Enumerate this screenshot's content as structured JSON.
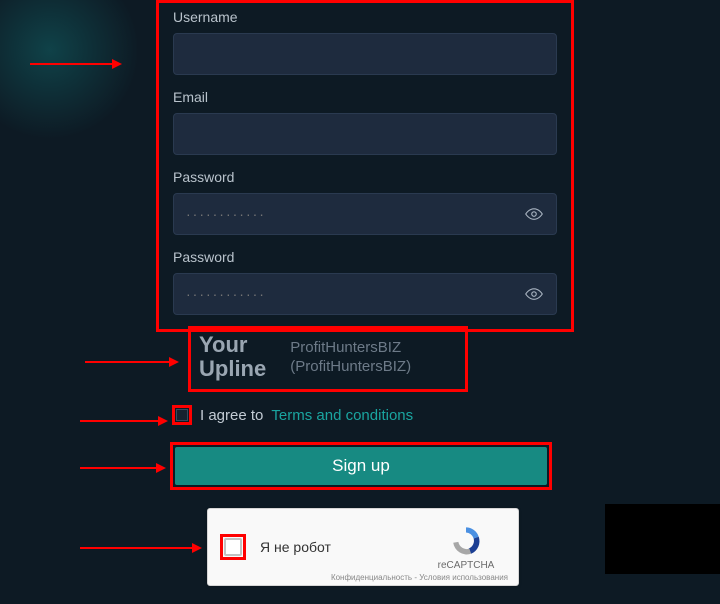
{
  "form": {
    "username_label": "Username",
    "username_value": "",
    "email_label": "Email",
    "email_value": "",
    "password1_label": "Password",
    "password1_placeholder": "············",
    "password2_label": "Password",
    "password2_placeholder": "············"
  },
  "upline": {
    "title_line1": "Your",
    "title_line2": "Upline",
    "value_line1": "ProfitHuntersBIZ",
    "value_line2": "(ProfitHuntersBIZ)"
  },
  "terms": {
    "prefix": "I agree to ",
    "link": "Terms and conditions"
  },
  "signup_label": "Sign up",
  "captcha": {
    "label": "Я не робот",
    "brand": "reCAPTCHA",
    "privacy": "Конфиденциальность",
    "dash": " - ",
    "terms": "Условия использования"
  }
}
